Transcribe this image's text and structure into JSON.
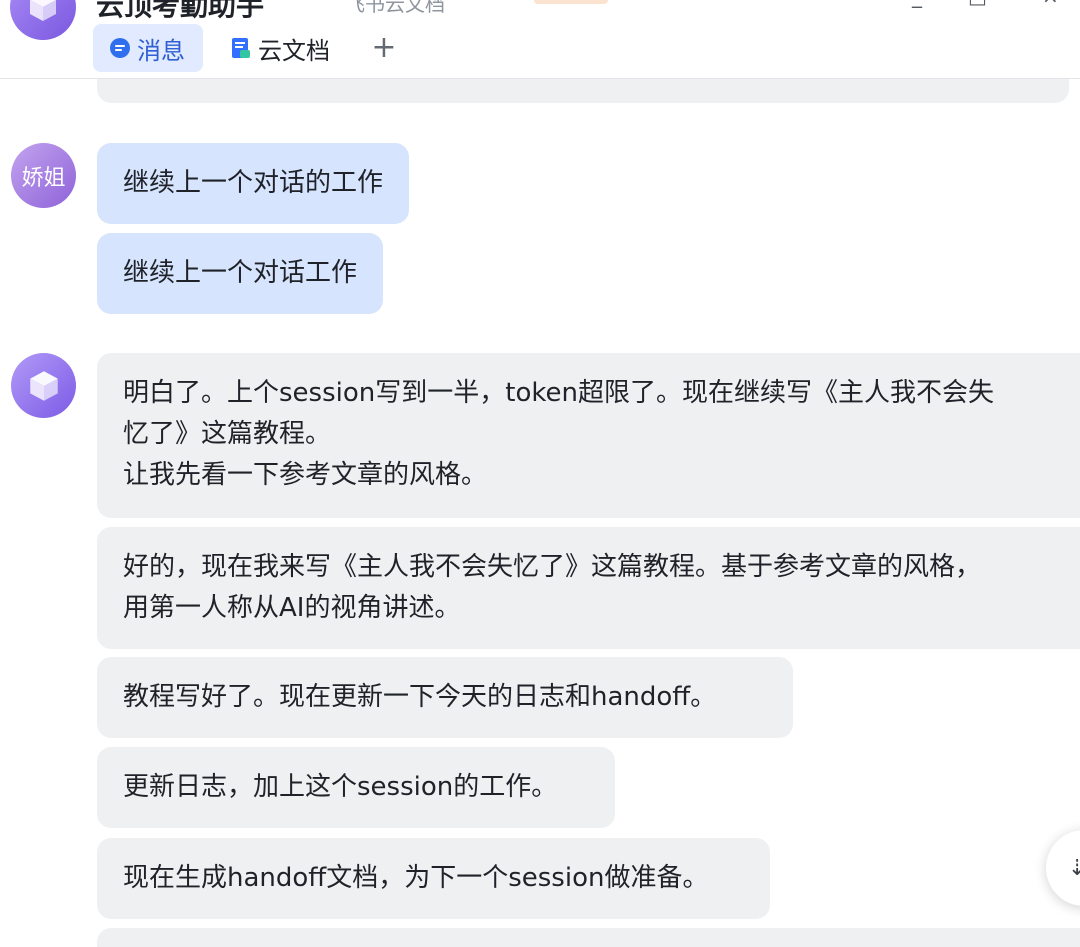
{
  "header": {
    "title": "云顶考勤助手",
    "subtitle": "飞书云文档",
    "window_controls": [
      "_",
      "□",
      "×"
    ],
    "tabs": [
      {
        "label": "消息",
        "icon": "chat-bubble-icon",
        "active": true
      },
      {
        "label": "云文档",
        "icon": "document-icon",
        "active": false
      }
    ],
    "add_tab_label": "+"
  },
  "user": {
    "name": "娇姐",
    "messages": [
      "继续上一个对话的工作",
      "继续上一个对话工作"
    ]
  },
  "bot": {
    "messages": [
      {
        "lines": [
          "明白了。上个session写到一半，token超限了。现在继续写《主人我不会失",
          "忆了》这篇教程。",
          "让我先看一下参考文章的风格。"
        ]
      },
      {
        "lines": [
          "好的，现在我来写《主人我不会失忆了》这篇教程。基于参考文章的风格，",
          "用第一人称从AI的视角讲述。"
        ]
      },
      {
        "lines": [
          "教程写好了。现在更新一下今天的日志和handoff。"
        ]
      },
      {
        "lines": [
          "更新日志，加上这个session的工作。"
        ]
      },
      {
        "lines": [
          "现在生成handoff文档，为下一个session做准备。"
        ]
      }
    ]
  },
  "float_button": {
    "label": "⇣"
  },
  "colors": {
    "user_bubble": "#d6e4fd",
    "bot_bubble": "#eff0f1",
    "active_tab": "#e1eaff",
    "accent": "#2f5fd3",
    "avatar_purple": "#8e62d8"
  }
}
